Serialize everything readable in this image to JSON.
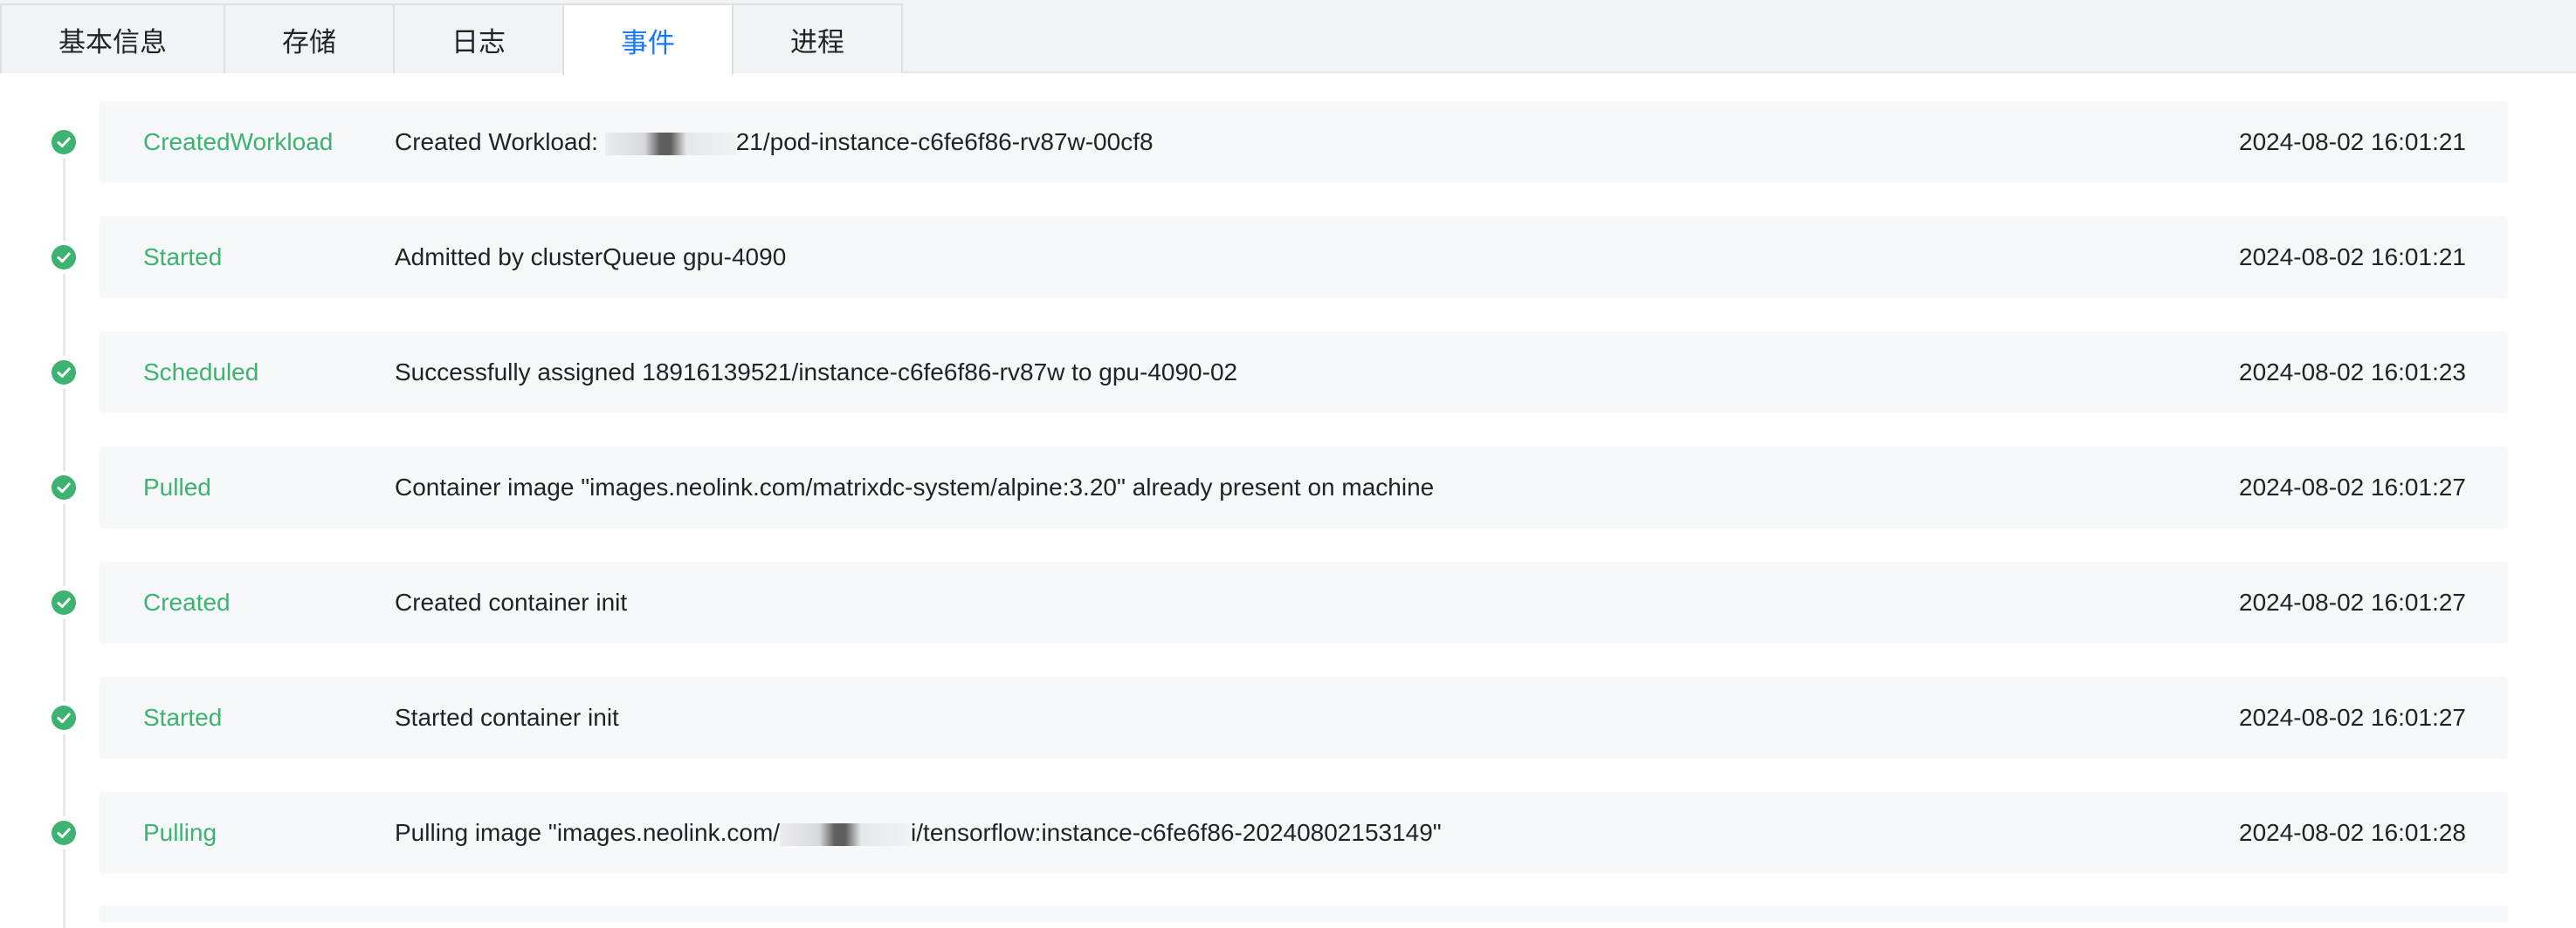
{
  "tabs": [
    {
      "label": "基本信息",
      "active": false
    },
    {
      "label": "存储",
      "active": false
    },
    {
      "label": "日志",
      "active": false
    },
    {
      "label": "事件",
      "active": true
    },
    {
      "label": "进程",
      "active": false
    }
  ],
  "colors": {
    "accent": "#1677ff",
    "success": "#3cb371",
    "card_bg": "#f7f8fa",
    "tab_bg": "#f2f3f5"
  },
  "events": [
    {
      "status_icon": "check-circle-icon",
      "reason": "CreatedWorkload",
      "message_prefix": "Created Workload: ",
      "message": "21/pod-instance-c6fe6f86-rv87w-00cf8",
      "time": "2024-08-02 16:01:21"
    },
    {
      "status_icon": "check-circle-icon",
      "reason": "Started",
      "message": "Admitted by clusterQueue gpu-4090",
      "time": "2024-08-02 16:01:21"
    },
    {
      "status_icon": "check-circle-icon",
      "reason": "Scheduled",
      "message": "Successfully assigned 18916139521/instance-c6fe6f86-rv87w to gpu-4090-02",
      "time": "2024-08-02 16:01:23"
    },
    {
      "status_icon": "check-circle-icon",
      "reason": "Pulled",
      "message": "Container image \"images.neolink.com/matrixdc-system/alpine:3.20\" already present on machine",
      "time": "2024-08-02 16:01:27"
    },
    {
      "status_icon": "check-circle-icon",
      "reason": "Created",
      "message": "Created container init",
      "time": "2024-08-02 16:01:27"
    },
    {
      "status_icon": "check-circle-icon",
      "reason": "Started",
      "message": "Started container init",
      "time": "2024-08-02 16:01:27"
    },
    {
      "status_icon": "check-circle-icon",
      "reason": "Pulling",
      "message_prefix": "Pulling image \"images.neolink.com/",
      "message": "i/tensorflow:instance-c6fe6f86-20240802153149\"",
      "time": "2024-08-02 16:01:28"
    }
  ]
}
